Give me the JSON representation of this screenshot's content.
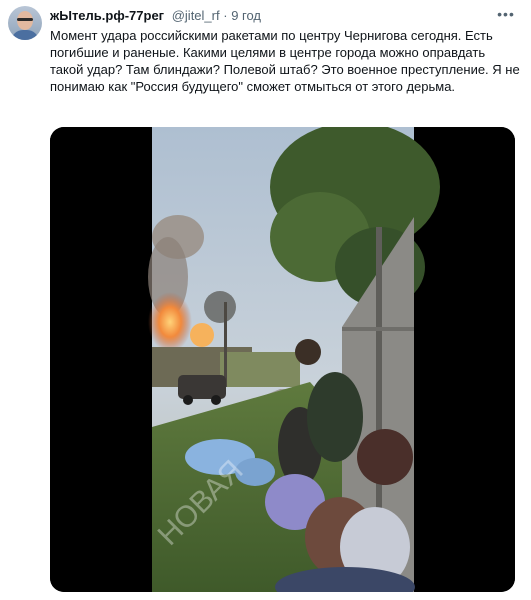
{
  "tweet": {
    "display_name": "жЫтель.рф-77рег",
    "handle": "@jitel_rf",
    "separator": "·",
    "time": "9 год",
    "text": "Момент удара российскими ракетами по центру Чернигова сегодня. Есть погибшие и раненые. Какими целями в центре города можно оправдать такой удар? Там блиндажи? Полевой штаб? Это военное преступление. Я не понимаю как \"Россия будущего\" сможет отмыться от этого дерьма.",
    "more_icon": "more-horizontal-icon"
  },
  "media": {
    "type": "video",
    "watermark": "НОВАЯ"
  }
}
